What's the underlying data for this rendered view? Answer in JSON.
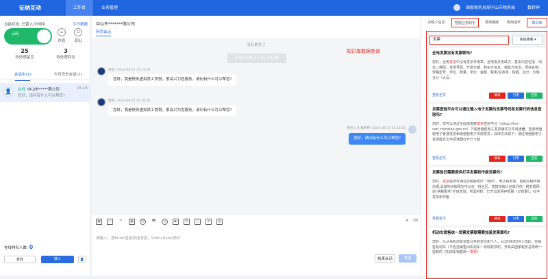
{
  "topbar": {
    "logo": "征纳互动",
    "tabs": [
      "工作台",
      "业务管理"
    ],
    "org": "国家税务总局中山市税务局",
    "user": "数转神"
  },
  "left": {
    "status": "当前状态: 已置入/示闲中",
    "stat_link": "今日数据",
    "toggle": "示闲",
    "rest": "休息",
    "exit": "退出",
    "counts": [
      {
        "value": "25",
        "label": "待处理留言"
      },
      {
        "value": "3",
        "label": "待处理回访"
      }
    ],
    "tabs": [
      "会话中(1)",
      "今日历史会话(2)"
    ],
    "session": {
      "badge": "在线",
      "name": "中山市*****限公司",
      "time": "15:16",
      "msg": "您好，请问有什么可以帮您?"
    },
    "queue_label": "在线排队人数:",
    "queue_value": "0",
    "btn_find": "查找",
    "btn_join": "接入"
  },
  "chat": {
    "title": "中山市*******限公司",
    "sub": "网页会话",
    "no_more": "没有更多了",
    "time_pill": "2023-06-17 15:13:29",
    "msgs": [
      {
        "meta": "悦悦 | 2023-06-17 15:13:29",
        "text": "您好，我是税务虚拟员工悦悦，很高兴为您服务，请问有什么可以帮您?"
      },
      {
        "meta": "悦悦 | 2023-06-17 15:16:36",
        "text": "您好，我是税务虚拟员工悦悦，很高兴为您服务，请问有什么可以帮您?"
      }
    ],
    "reply": {
      "meta": "税务人员 数转神 | 2023-06-17 15:16:55",
      "text": "您好，请问有什么可以帮您?"
    },
    "input_hint": "请输入，按Enter直接发送消息，Shift+Enter换行",
    "btn_end": "结束会话",
    "btn_send": "发送"
  },
  "right": {
    "tabs": [
      "办税人信息",
      "智能业务助手",
      "常用链接",
      "常用话术",
      "知识库"
    ],
    "search_value": "发票",
    "adv_label": "高级搜索",
    "annotation": "知识库数据查询",
    "labels": {
      "full": "查看全文",
      "quote": "引用",
      "reply": "回答",
      "copy": "摘录"
    },
    "cards": [
      {
        "q": "全电发票没有发票联吗?",
        "pre": "您好，全电",
        "hl": "发票",
        "post": "中没有发票专用章。全电发票无联次，基本内容包括：动态二维码、发票号码、开票日期、购买方信息、销售方信息、项目名称、规格型号、单位、数量、单价、金额、税率/征收率、税额、合计、价税合计（大写、"
      },
      {
        "q": "发票查验平台可以通过输入电子发票的发票号码和发票代码信息查验吗?",
        "pre": "您好，您可以通过全国增值税",
        "hl": "发票",
        "post": "查验平台（https://inv-veri.chinatax.gov.cn）下载增值税电子发票版式文件阅读器，查阅增值税电子普通发票和增值税电子专用发票，具体方法如下：通过增值税电子发票版式文件阅读器打开已下载"
      },
      {
        "q": "发票验旧需要提供打字发票和作废发票吗?",
        "pre": "您好，",
        "hl": "发票",
        "post": "验旧可通过办税服务厅（场所）、电子税务局、自助办税终端办理,具体地点和网址可从省（自治区、直辖市和计划单列市）税务局网站\"纳税服务\"栏目查询。所需材料：已开具发票存根联（记账联），红字发票和作废"
      },
      {
        "q": "机动车销售统一发票发票联需要加盖发票章吗?",
        "pre": "您好，凡从事机动车零售业务的单位和个人，从2006年8月1日起，在销售机动车（不包括销售旧机动车）收取款项时，开具由国家税务总局统一监制的《机动车销售统一",
        "hl": "发票",
        "post": "》"
      }
    ]
  }
}
